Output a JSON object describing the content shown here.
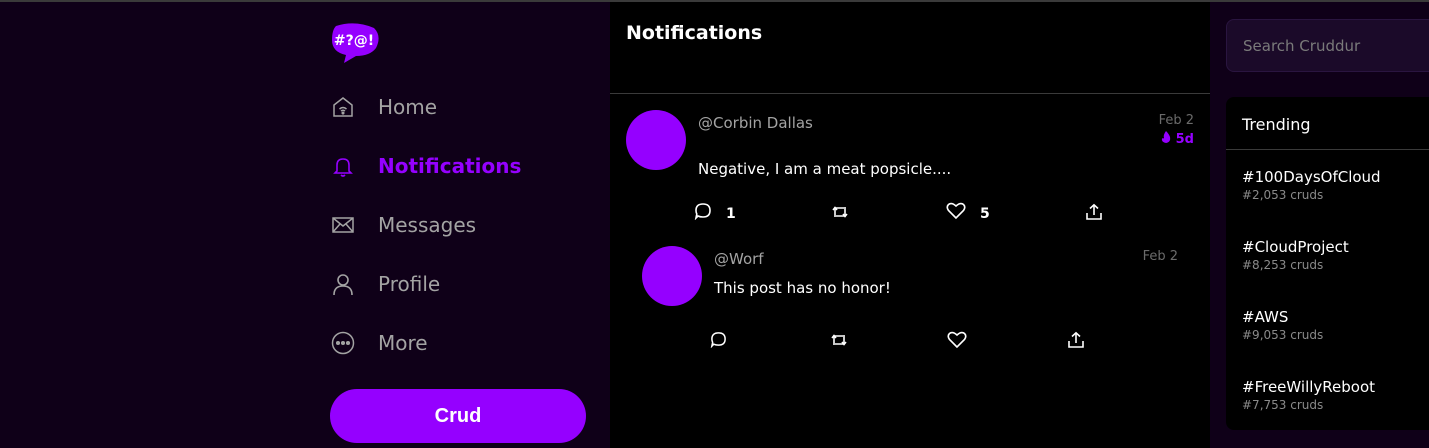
{
  "logo": {
    "text": "#?@!"
  },
  "nav": {
    "items": [
      {
        "label": "Home",
        "icon": "home-icon",
        "active": false
      },
      {
        "label": "Notifications",
        "icon": "bell-icon",
        "active": true
      },
      {
        "label": "Messages",
        "icon": "envelope-icon",
        "active": false
      },
      {
        "label": "Profile",
        "icon": "user-icon",
        "active": false
      },
      {
        "label": "More",
        "icon": "more-icon",
        "active": false
      }
    ],
    "crud_button": "Crud"
  },
  "feed": {
    "title": "Notifications",
    "post": {
      "handle": "@Corbin Dallas",
      "date": "Feb 2",
      "ttl": "5d",
      "message": "Negative, I am a meat popsicle....",
      "reply_count": "1",
      "like_count": "5"
    },
    "reply": {
      "handle": "@Worf",
      "date": "Feb 2",
      "message": "This post has no honor!"
    }
  },
  "search": {
    "placeholder": "Search Cruddur"
  },
  "trending": {
    "title": "Trending",
    "items": [
      {
        "tag": "#100DaysOfCloud",
        "count": "#2,053 cruds"
      },
      {
        "tag": "#CloudProject",
        "count": "#8,253 cruds"
      },
      {
        "tag": "#AWS",
        "count": "#9,053 cruds"
      },
      {
        "tag": "#FreeWillyReboot",
        "count": "#7,753 cruds"
      }
    ]
  },
  "colors": {
    "accent": "#9500ff",
    "sidebar_bg": "#0f0018",
    "feed_bg": "#000000"
  }
}
